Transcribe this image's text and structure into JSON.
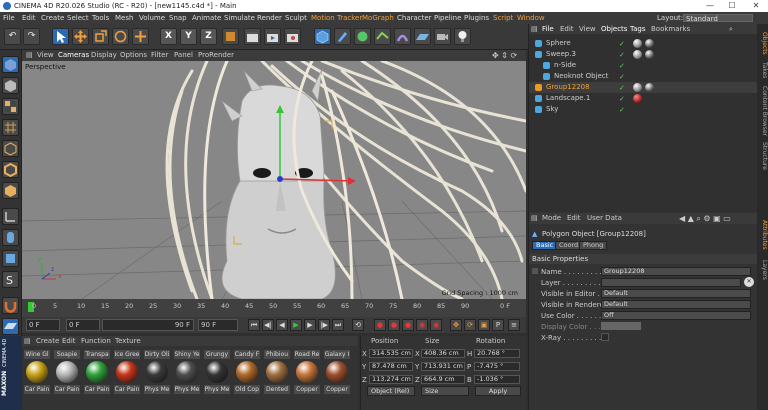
{
  "window": {
    "title": "CINEMA 4D R20.026 Studio (RC - R20) - [new1145.c4d *] - Main",
    "minimize": "—",
    "maximize": "☐",
    "close": "✕"
  },
  "menu": {
    "items": [
      "File",
      "Edit",
      "Create",
      "Select",
      "Tools",
      "Mesh",
      "Volume",
      "Snap",
      "Animate",
      "Simulate",
      "Render",
      "Sculpt",
      "Motion Tracker",
      "MoGraph",
      "Character",
      "Pipeline",
      "Plugins",
      "Script",
      "Window"
    ],
    "highlighted": [
      "Motion Tracker",
      "MoGraph",
      "Script",
      "Window"
    ],
    "layout_label": "Layout:",
    "layout_value": "Standard"
  },
  "toolbar": {
    "undo": "↶",
    "redo": "↷",
    "x_axis": "X",
    "y_axis": "Y",
    "z_axis": "Z"
  },
  "viewport": {
    "menu": [
      "View",
      "Cameras",
      "Display",
      "Options",
      "Filter",
      "Panel",
      "ProRender"
    ],
    "camera_label": "Perspective",
    "grid_spacing": "Grid Spacing : 1000 cm",
    "axis_x": "x",
    "axis_y": "y",
    "axis_z": "z"
  },
  "timeline": {
    "ticks": [
      "0",
      "5",
      "10",
      "15",
      "20",
      "25",
      "30",
      "35",
      "40",
      "45",
      "50",
      "55",
      "60",
      "65",
      "70",
      "75",
      "80",
      "85",
      "90"
    ],
    "end_frame": "0 F"
  },
  "playback": {
    "current_frame": "0 F",
    "start_field": "0 F",
    "preview_end": "90 F",
    "end_field": "90 F"
  },
  "materials": {
    "menu": [
      "Create",
      "Edit",
      "Function",
      "Texture"
    ],
    "top_row": [
      "Wine Gl",
      "Soapie",
      "Transpa",
      "Ice Gree",
      "Dirty Oli",
      "Shiny Ye",
      "Grungy",
      "Candy F",
      "Phibiou",
      "Road Re",
      "Galaxy I"
    ],
    "bottom_row": [
      "Car Pain",
      "Car Pain",
      "Car Pain",
      "Car Pain",
      "Phys Me",
      "Phys Me",
      "Phys Me",
      "Old Cop",
      "Dented",
      "Copper",
      "Copper"
    ],
    "colors": [
      "#c9a316",
      "#b8b8b8",
      "#2ea33a",
      "#c8351a",
      "#3a3a3a",
      "#4e4e4e",
      "#343434",
      "#b06a2a",
      "#a07040",
      "#c8763a",
      "#9e4f2c"
    ],
    "logo_text": [
      "MAXON",
      "CINEMA 4D"
    ]
  },
  "coordinates": {
    "headers": [
      "Position",
      "Size",
      "Rotation"
    ],
    "rows": [
      {
        "axis": "X",
        "position": "314.535 cm",
        "size": "408.36 cm",
        "rot_label": "H",
        "rotation": "20.768 °"
      },
      {
        "axis": "Y",
        "position": "87.478 cm",
        "size": "713.931 cm",
        "rot_label": "P",
        "rotation": "-7.475 °"
      },
      {
        "axis": "Z",
        "position": "113.274 cm",
        "size": "664.9 cm",
        "rot_label": "B",
        "rotation": "-1.036 °"
      }
    ],
    "mode_select": "Object (Rel)",
    "size_select": "Size",
    "apply_button": "Apply"
  },
  "objects": {
    "menu": [
      "File",
      "Edit",
      "View",
      "Objects",
      "Tags",
      "Bookmarks"
    ],
    "items": [
      {
        "name": "Sphere",
        "indent": 0,
        "color": "#4ea8e0",
        "selected": false
      },
      {
        "name": "Sweep.3",
        "indent": 0,
        "color": "#4ea8e0",
        "selected": false
      },
      {
        "name": "n-Side",
        "indent": 1,
        "color": "#4ea8e0",
        "selected": false
      },
      {
        "name": "Neoknot Object",
        "indent": 1,
        "color": "#4ea8e0",
        "selected": false
      },
      {
        "name": "Group12208",
        "indent": 0,
        "color": "#e89a2a",
        "selected": true
      },
      {
        "name": "Landscape.1",
        "indent": 0,
        "color": "#4ea8e0",
        "selected": false
      },
      {
        "name": "Sky",
        "indent": 0,
        "color": "#4ea8e0",
        "selected": false
      }
    ]
  },
  "attributes": {
    "menu": [
      "Mode",
      "Edit",
      "User Data"
    ],
    "object_title": "Polygon Object [Group12208]",
    "tabs": [
      "Basic",
      "Coord.",
      "Phong"
    ],
    "section": "Basic Properties",
    "fields": [
      {
        "label": "Name . . . . . . . . . .",
        "value": "Group12208"
      },
      {
        "label": "Layer . . . . . . . . . .",
        "value": ""
      },
      {
        "label": "Visible in Editor . . .",
        "value": "Default"
      },
      {
        "label": "Visible in Renderer .",
        "value": "Default"
      },
      {
        "label": "Use Color . . . . . . . .",
        "value": "Off"
      },
      {
        "label": "Display Color . . . . .",
        "value": ""
      },
      {
        "label": "X-Ray . . . . . . . . . .",
        "value": ""
      }
    ]
  },
  "side_tabs": [
    "Objects",
    "Takes",
    "Content Browser",
    "Structure",
    "Attributes",
    "Layers"
  ]
}
